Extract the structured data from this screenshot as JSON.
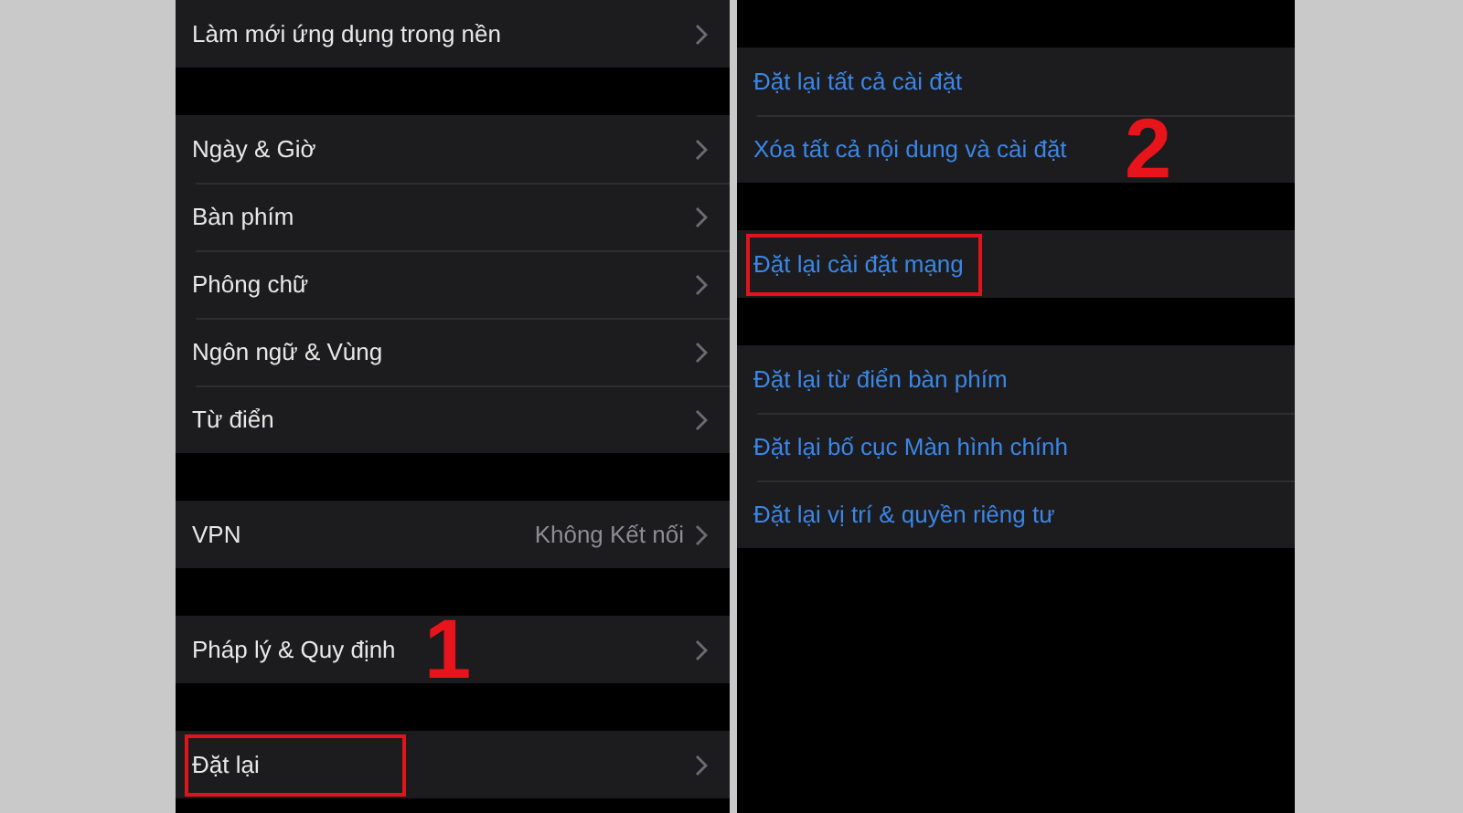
{
  "panels": [
    {
      "top_spacer": false,
      "groups": [
        [
          {
            "label": "Làm mới ứng dụng trong nền",
            "kind": "nav",
            "highlighted": false
          }
        ],
        [
          {
            "label": "Ngày & Giờ",
            "kind": "nav",
            "highlighted": false
          },
          {
            "label": "Bàn phím",
            "kind": "nav",
            "highlighted": false
          },
          {
            "label": "Phông chữ",
            "kind": "nav",
            "highlighted": false
          },
          {
            "label": "Ngôn ngữ & Vùng",
            "kind": "nav",
            "highlighted": false
          },
          {
            "label": "Từ điển",
            "kind": "nav",
            "highlighted": false
          }
        ],
        [
          {
            "label": "VPN",
            "value": "Không Kết nối",
            "kind": "nav",
            "highlighted": false
          }
        ],
        [
          {
            "label": "Pháp lý & Quy định",
            "kind": "nav",
            "highlighted": false,
            "step_label": "1"
          }
        ],
        [
          {
            "label": "Đặt lại",
            "kind": "nav",
            "highlighted": true
          }
        ]
      ]
    },
    {
      "top_spacer": true,
      "groups": [
        [
          {
            "label": "Đặt lại tất cả cài đặt",
            "kind": "action",
            "highlighted": false
          },
          {
            "label": "Xóa tất cả nội dung và cài đặt",
            "kind": "action",
            "highlighted": false,
            "step_label": "2"
          }
        ],
        [
          {
            "label": "Đặt lại cài đặt mạng",
            "kind": "action",
            "highlighted": true
          }
        ],
        [
          {
            "label": "Đặt lại từ điển bàn phím",
            "kind": "action",
            "highlighted": false
          },
          {
            "label": "Đặt lại bố cục Màn hình chính",
            "kind": "action",
            "highlighted": false
          },
          {
            "label": "Đặt lại vị trí & quyền riêng tư",
            "kind": "action",
            "highlighted": false
          }
        ]
      ]
    }
  ]
}
